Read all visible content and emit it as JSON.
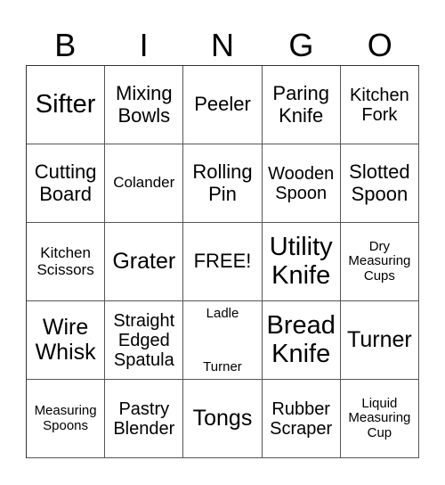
{
  "header": {
    "letters": [
      "B",
      "I",
      "N",
      "G",
      "O"
    ]
  },
  "grid": {
    "rows": [
      [
        {
          "label": "Sifter",
          "size": "xl"
        },
        {
          "label": "Mixing\nBowls",
          "size": "m"
        },
        {
          "label": "Peeler",
          "size": "m"
        },
        {
          "label": "Paring\nKnife",
          "size": "m"
        },
        {
          "label": "Kitchen\nFork",
          "size": "ms"
        }
      ],
      [
        {
          "label": "Cutting\nBoard",
          "size": "m"
        },
        {
          "label": "Colander",
          "size": "s"
        },
        {
          "label": "Rolling\nPin",
          "size": "m"
        },
        {
          "label": "Wooden\nSpoon",
          "size": "ms"
        },
        {
          "label": "Slotted\nSpoon",
          "size": "m"
        }
      ],
      [
        {
          "label": "Kitchen\nScissors",
          "size": "s"
        },
        {
          "label": "Grater",
          "size": "l"
        },
        {
          "label": "FREE!",
          "size": "m",
          "free": true
        },
        {
          "label": "Utility\nKnife",
          "size": "xl"
        },
        {
          "label": "Dry\nMeasuring\nCups",
          "size": "xs"
        }
      ],
      [
        {
          "label": "Wire\nWhisk",
          "size": "l"
        },
        {
          "label": "Straight\nEdged\nSpatula",
          "size": "ms"
        },
        {
          "top": "Ladle",
          "bottom": "Turner",
          "size": "xs"
        },
        {
          "label": "Bread\nKnife",
          "size": "xl"
        },
        {
          "label": "Turner",
          "size": "l"
        }
      ],
      [
        {
          "label": "Measuring\nSpoons",
          "size": "xs"
        },
        {
          "label": "Pastry\nBlender",
          "size": "ms"
        },
        {
          "label": "Tongs",
          "size": "l"
        },
        {
          "label": "Rubber\nScraper",
          "size": "ms"
        },
        {
          "label": "Liquid\nMeasuring\nCup",
          "size": "xs"
        }
      ]
    ]
  }
}
